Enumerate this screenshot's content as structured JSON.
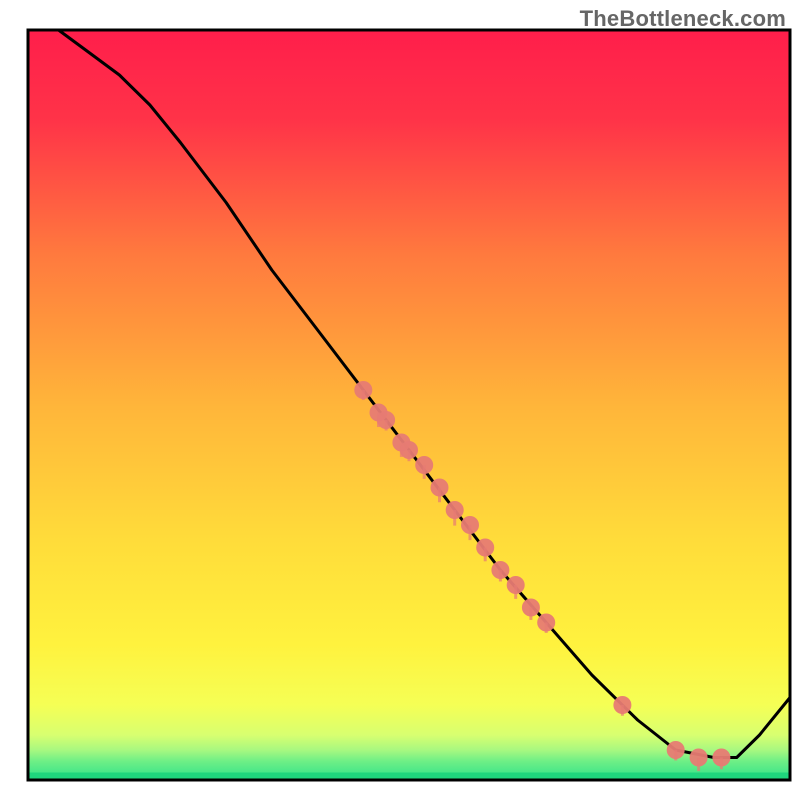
{
  "watermark": "TheBottleneck.com",
  "chart_data": {
    "type": "line",
    "title": "",
    "xlabel": "",
    "ylabel": "",
    "xlim": [
      0,
      100
    ],
    "ylim": [
      0,
      100
    ],
    "background_gradient": {
      "top_color": "#ff1e4b",
      "mid_color": "#ffdc3a",
      "bottom_band_color": "#2ee28a",
      "bottom_band_height_pct": 4
    },
    "curve": [
      {
        "x": 4,
        "y": 100
      },
      {
        "x": 8,
        "y": 97
      },
      {
        "x": 12,
        "y": 94
      },
      {
        "x": 16,
        "y": 90
      },
      {
        "x": 20,
        "y": 85
      },
      {
        "x": 26,
        "y": 77
      },
      {
        "x": 32,
        "y": 68
      },
      {
        "x": 38,
        "y": 60
      },
      {
        "x": 44,
        "y": 52
      },
      {
        "x": 50,
        "y": 44
      },
      {
        "x": 56,
        "y": 36
      },
      {
        "x": 62,
        "y": 28
      },
      {
        "x": 68,
        "y": 21
      },
      {
        "x": 74,
        "y": 14
      },
      {
        "x": 80,
        "y": 8
      },
      {
        "x": 85,
        "y": 4
      },
      {
        "x": 90,
        "y": 3
      },
      {
        "x": 93,
        "y": 3
      },
      {
        "x": 96,
        "y": 6
      },
      {
        "x": 100,
        "y": 11
      }
    ],
    "points": [
      {
        "x": 44,
        "y": 52
      },
      {
        "x": 46,
        "y": 49
      },
      {
        "x": 47,
        "y": 48
      },
      {
        "x": 49,
        "y": 45
      },
      {
        "x": 50,
        "y": 44
      },
      {
        "x": 52,
        "y": 42
      },
      {
        "x": 54,
        "y": 39
      },
      {
        "x": 56,
        "y": 36
      },
      {
        "x": 58,
        "y": 34
      },
      {
        "x": 60,
        "y": 31
      },
      {
        "x": 62,
        "y": 28
      },
      {
        "x": 64,
        "y": 26
      },
      {
        "x": 66,
        "y": 23
      },
      {
        "x": 68,
        "y": 21
      },
      {
        "x": 78,
        "y": 10
      },
      {
        "x": 85,
        "y": 4
      },
      {
        "x": 88,
        "y": 3
      },
      {
        "x": 91,
        "y": 3
      }
    ],
    "point_color": "#e77b73",
    "line_color": "#000000"
  }
}
